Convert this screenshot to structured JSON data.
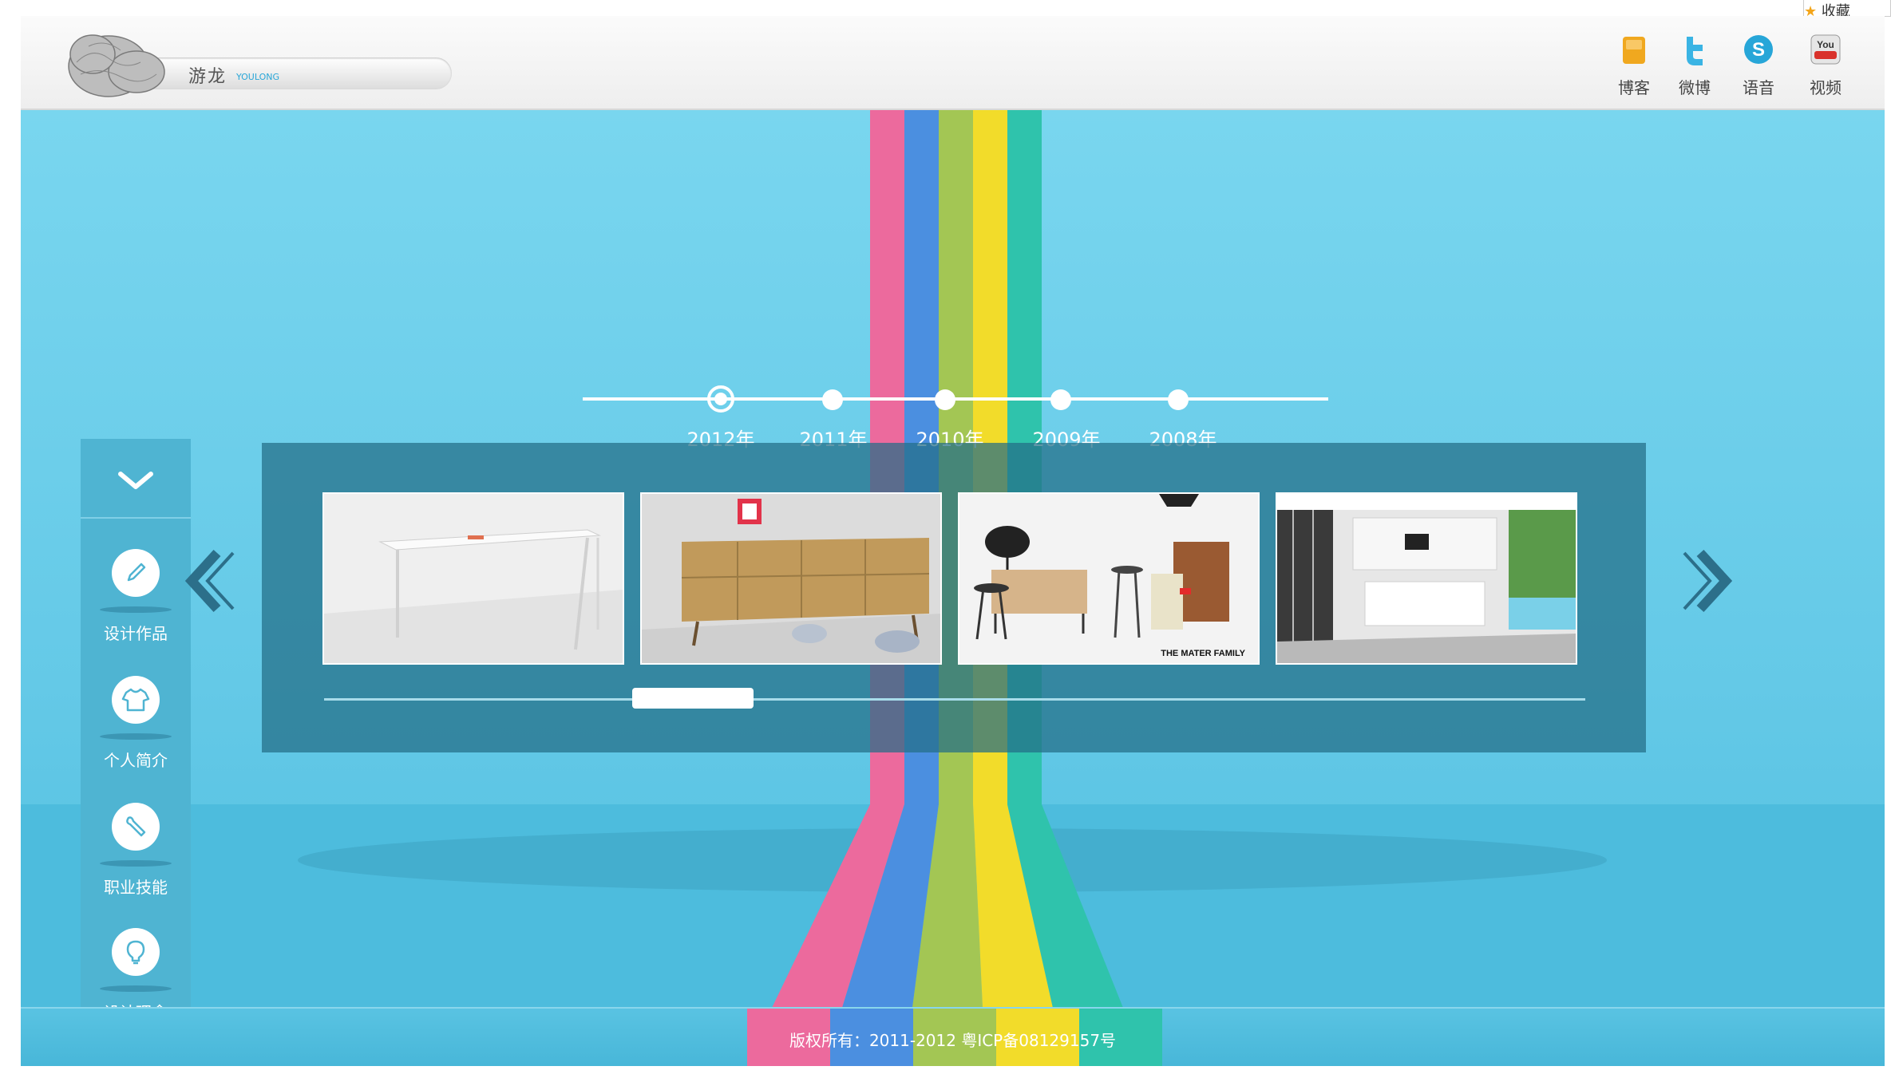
{
  "header": {
    "brand_name": "游龙",
    "brand_sub": "YOULONG",
    "social": [
      {
        "label": "博客",
        "icon": "blog-icon"
      },
      {
        "label": "微博",
        "icon": "twitter-bird-icon"
      },
      {
        "label": "语音",
        "icon": "skype-icon"
      },
      {
        "label": "视频",
        "icon": "youtube-icon"
      }
    ],
    "favorite_label": "收藏"
  },
  "timeline": {
    "years": [
      "2012年",
      "2011年",
      "2010年",
      "2009年",
      "2008年"
    ],
    "active_index": 0
  },
  "sidebar": {
    "items": [
      {
        "label": "设计作品",
        "icon": "pencil-icon"
      },
      {
        "label": "个人简介",
        "icon": "shirt-icon"
      },
      {
        "label": "职业技能",
        "icon": "wrench-icon"
      },
      {
        "label": "设计理念",
        "icon": "lightbulb-icon"
      }
    ]
  },
  "gallery": {
    "images": [
      {
        "caption": "",
        "icon": "white-desk-photo"
      },
      {
        "caption": "",
        "icon": "wooden-sideboard-photo"
      },
      {
        "caption": "THE MATER FAMILY",
        "icon": "mater-furniture-photo"
      },
      {
        "caption": "",
        "icon": "kitchen-interior-photo"
      }
    ],
    "scroll_position": 0.27
  },
  "colors": {
    "stripes": [
      "#ec6a9d",
      "#4b8fe0",
      "#a3c654",
      "#f2dc2a",
      "#2fc3ac"
    ],
    "background": "#6ccfea"
  },
  "footer": {
    "copyright": "版权所有：2011-2012 粤ICP备08129157号"
  }
}
